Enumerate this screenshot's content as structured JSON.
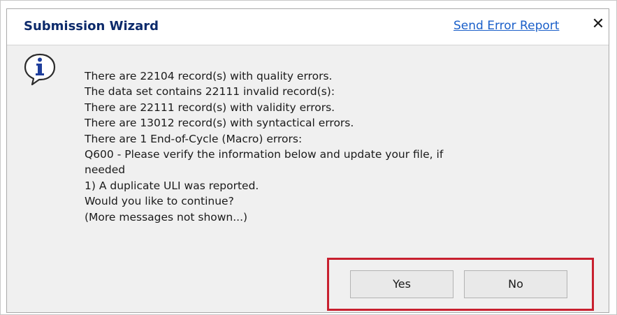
{
  "dialog": {
    "title": "Submission Wizard",
    "send_error_report": "Send Error Report",
    "close_symbol": "✕",
    "icon": "info-icon",
    "messages": [
      "There are 22104 record(s) with quality errors.",
      "The data set contains 22111 invalid record(s):",
      "There are 22111 record(s) with validity errors.",
      "There are 13012 record(s) with syntactical errors.",
      "There are 1 End-of-Cycle (Macro) errors:",
      "Q600 - Please verify the information below and update your file, if",
      "needed",
      "1) A duplicate ULI was reported.",
      "Would you like to continue?",
      "(More messages not shown...)"
    ],
    "buttons": {
      "yes": "Yes",
      "no": "No"
    }
  },
  "colors": {
    "title": "#0c2a6b",
    "link": "#1a5fc9",
    "highlight_box": "#c8202f",
    "dialog_background": "#f0f0f0"
  }
}
